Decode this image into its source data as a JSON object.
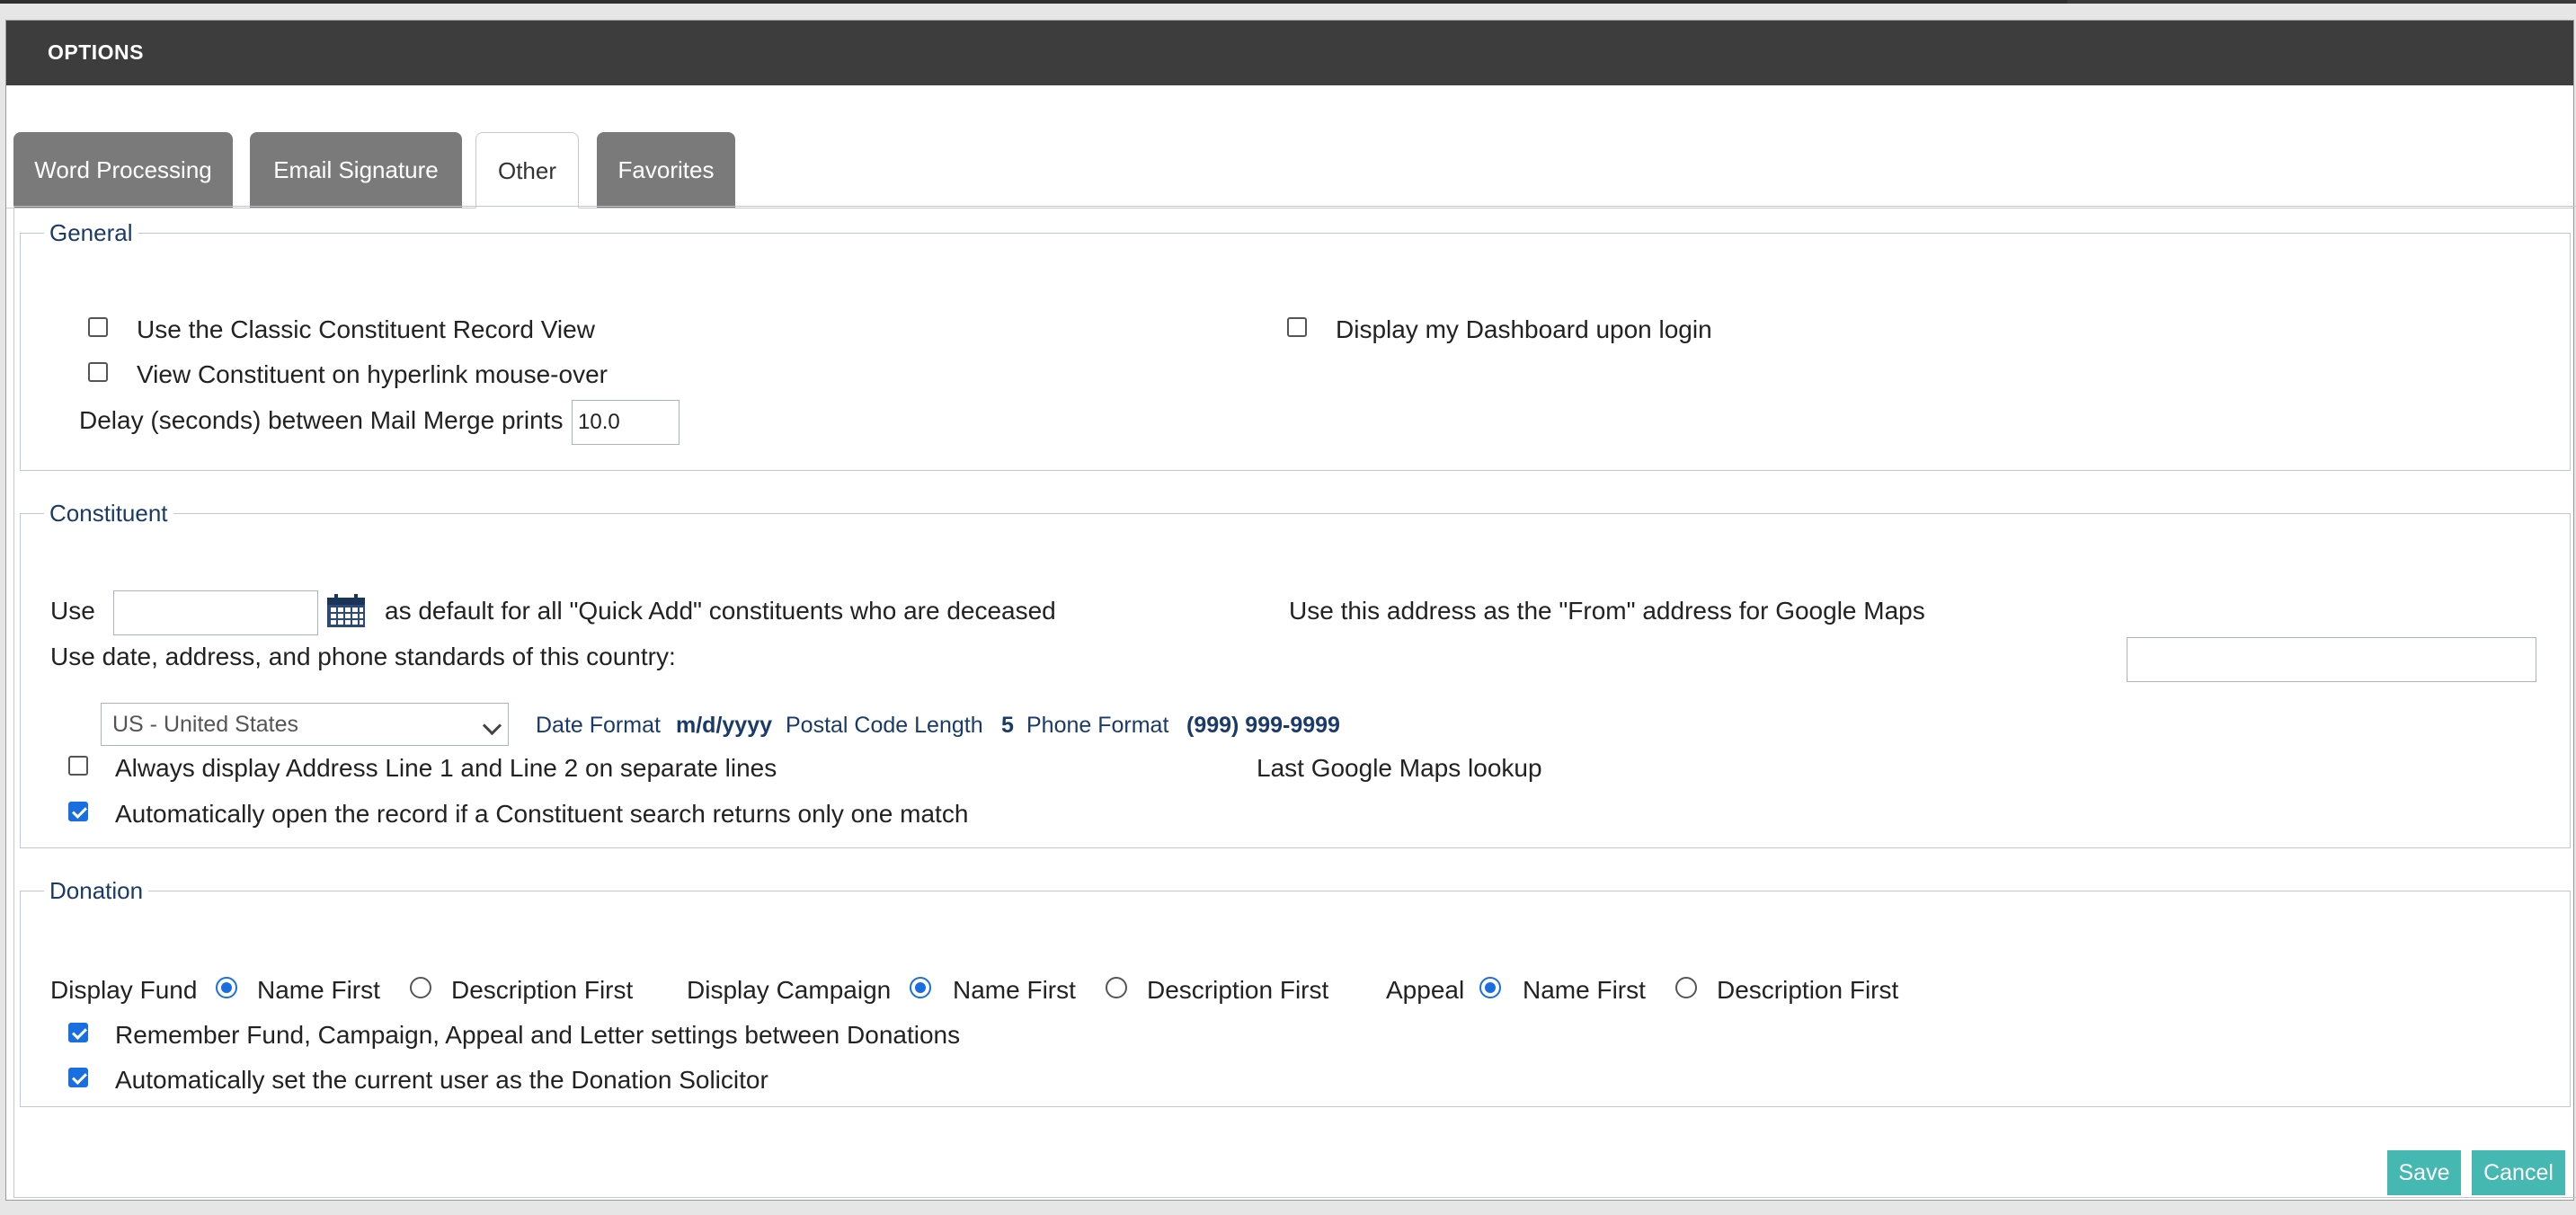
{
  "dialog": {
    "title": "OPTIONS"
  },
  "tabs": [
    {
      "label": "Word Processing",
      "active": false
    },
    {
      "label": "Email Signature",
      "active": false
    },
    {
      "label": "Other",
      "active": true
    },
    {
      "label": "Favorites",
      "active": false
    }
  ],
  "general": {
    "legend": "General",
    "classic_view_label": "Use the Classic Constituent Record View",
    "classic_view_checked": false,
    "hover_label": "View Constituent on hyperlink mouse-over",
    "hover_checked": false,
    "dashboard_label": "Display my Dashboard upon login",
    "dashboard_checked": false,
    "delay_label": "Delay (seconds) between Mail Merge prints",
    "delay_value": "10.0"
  },
  "constituent": {
    "legend": "Constituent",
    "use_label": "Use",
    "deceased_date_value": "",
    "deceased_label": "as default for all \"Quick Add\" constituents who are deceased",
    "google_from_label": "Use this address as the \"From\" address for Google Maps",
    "google_from_value": "",
    "country_standards_label": "Use date, address, and phone standards of this country:",
    "country_selected": "US - United States",
    "date_format_label": "Date Format",
    "date_format_value": "m/d/yyyy",
    "postal_label": "Postal Code Length",
    "postal_value": "5",
    "phone_label": "Phone Format",
    "phone_value": "(999) 999-9999",
    "separate_lines_label": "Always display Address Line 1 and Line 2 on separate lines",
    "separate_lines_checked": false,
    "last_google_label": "Last Google Maps lookup",
    "auto_open_label": "Automatically open the record if a Constituent search returns only one match",
    "auto_open_checked": true
  },
  "donation": {
    "legend": "Donation",
    "display_fund_label": "Display Fund",
    "display_campaign_label": "Display Campaign",
    "appeal_label": "Appeal",
    "name_first_label": "Name First",
    "description_first_label": "Description First",
    "fund_selection": "Name First",
    "campaign_selection": "Name First",
    "appeal_selection": "Name First",
    "remember_label": "Remember Fund, Campaign, Appeal and Letter settings between Donations",
    "remember_checked": true,
    "solicitor_label": "Automatically set the current user as the Donation Solicitor",
    "solicitor_checked": true
  },
  "buttons": {
    "save": "Save",
    "cancel": "Cancel"
  },
  "colors": {
    "accent": "#45b8b1",
    "checked": "#1a6fe0",
    "titlebar": "#3d3d3d",
    "tab_inactive": "#7a7a7a"
  }
}
